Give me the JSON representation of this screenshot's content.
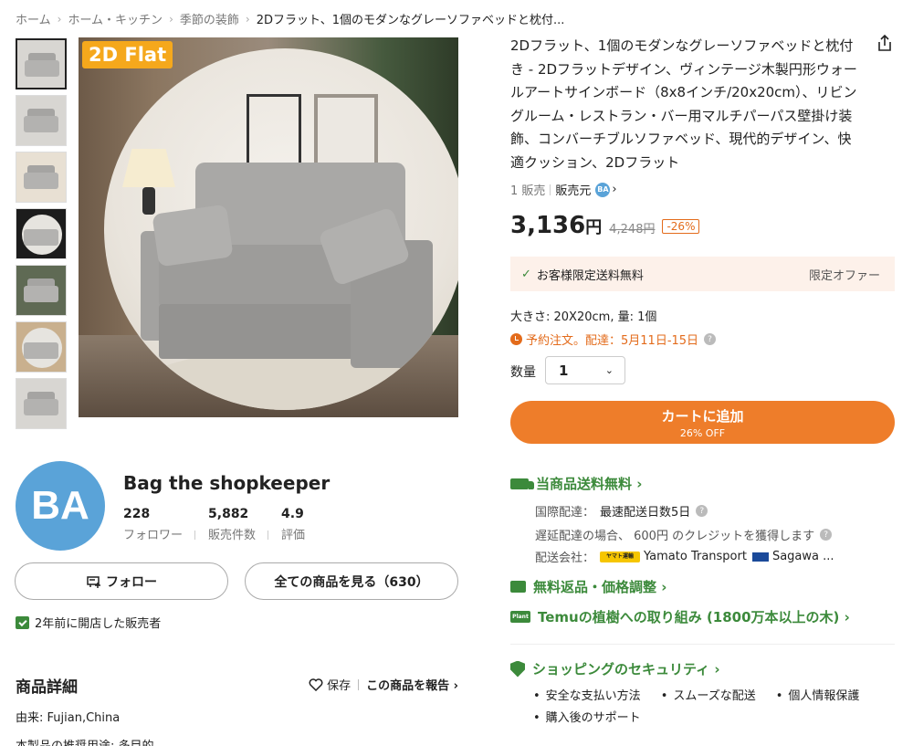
{
  "breadcrumb": [
    "ホーム",
    "ホーム・キッチン",
    "季節の装飾",
    "2Dフラット、1個のモダンなグレーソファベッドと枕付..."
  ],
  "gallery": {
    "badge": "2D Flat"
  },
  "product": {
    "title": "2Dフラット、1個のモダンなグレーソファベッドと枕付き - 2Dフラットデザイン、ヴィンテージ木製円形ウォールアートサインボード（8x8インチ/20x20cm）、リビングルーム・レストラン・バー用マルチパーパス壁掛け装飾、コンバーチブルソファベッド、現代的デザイン、快適クッション、2Dフラット",
    "sold": "1 販売",
    "seller_label": "販売元",
    "seller_badge": "BA",
    "price": "3,136",
    "currency": "円",
    "old_price": "4,248円",
    "discount": "-26%",
    "promo_text": "お客様限定送料無料",
    "promo_right": "限定オファー",
    "size_line": "大きさ: 20X20cm, 量: 1個",
    "preorder": "予約注文。配達：5月11日-15日",
    "qty_label": "数量",
    "qty_value": "1",
    "cart_label": "カートに追加",
    "cart_sub": "26% OFF"
  },
  "shipping": {
    "free_label": "当商品送料無料 ›",
    "intl_label": "国際配達：",
    "intl_value": "最速配送日数5日",
    "delay_text": "遅延配達の場合、 600円 のクレジットを獲得します",
    "carrier_label": "配送会社：",
    "yamato_logo": "ヤマト運輸",
    "carrier1": "Yamato Transport",
    "carrier2": "Sagawa ...",
    "returns": "無料返品・価格調整 ›",
    "plant_label": "Plant",
    "trees": "Temuの植樹への取り組み (1800万本以上の木) ›",
    "security_title": "ショッピングのセキュリティ ›",
    "security_items": [
      "安全な支払い方法",
      "スムーズな配送",
      "個人情報保護",
      "購入後のサポート"
    ]
  },
  "shop": {
    "avatar": "BA",
    "name": "Bag the shopkeeper",
    "stats": [
      {
        "num": "228",
        "label": "フォロワー"
      },
      {
        "num": "5,882",
        "label": "販売件数"
      },
      {
        "num": "4.9",
        "label": "評価"
      }
    ],
    "follow_label": "フォロー",
    "all_label": "全ての商品を見る（630）",
    "opened": "2年前に開店した販売者"
  },
  "details": {
    "title": "商品詳細",
    "save": "保存",
    "report": "この商品を報告 ›",
    "origin": "由来: Fujian,China",
    "usage": "本製品の推奨用途: 多目的"
  },
  "colors": {
    "accent": "#ee7d2a",
    "green": "#3c8a3b",
    "avatar": "#5aa3d8"
  }
}
